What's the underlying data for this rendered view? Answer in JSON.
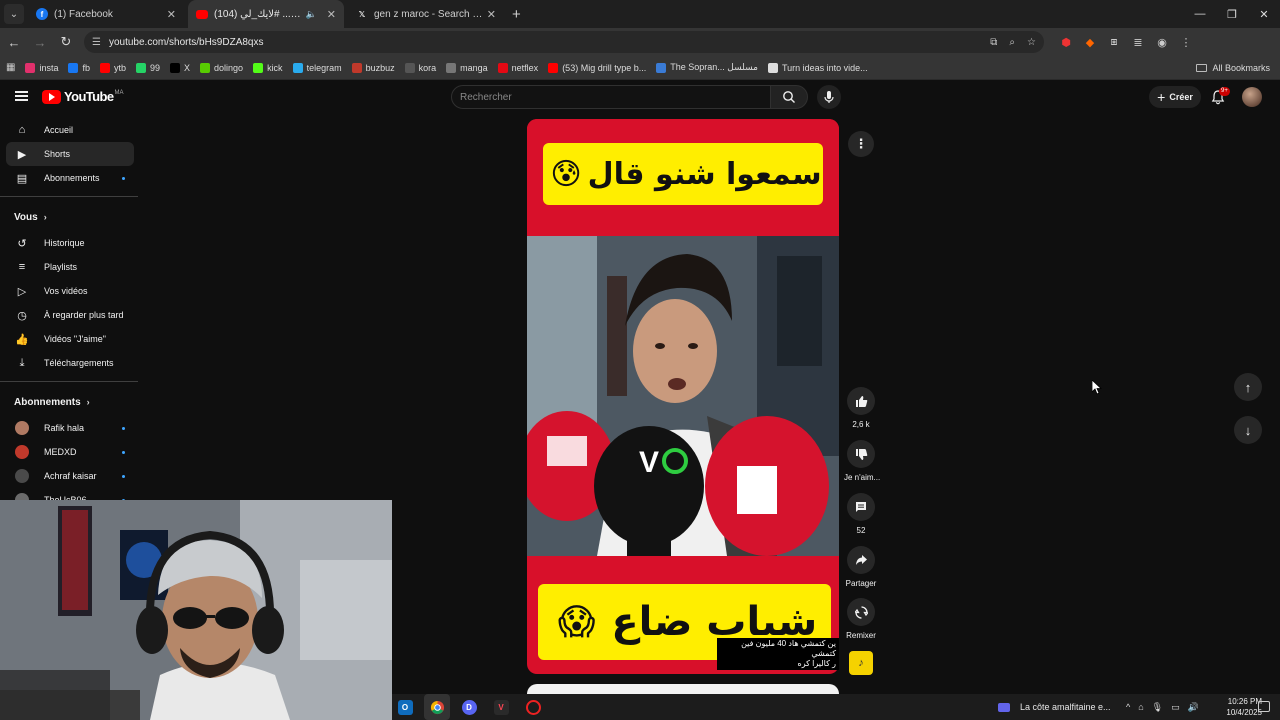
{
  "browser": {
    "tabs": [
      {
        "title": "(1) Facebook",
        "active": false,
        "favicon": "facebook-icon",
        "color": "#1877f2"
      },
      {
        "title": "(104) شباب ضاع... #لايك_لي",
        "active": true,
        "favicon": "youtube-icon",
        "color": "#ff0000"
      },
      {
        "title": "gen z maroc - Search / X",
        "active": false,
        "favicon": "x-icon",
        "color": "#000000"
      }
    ],
    "url": "youtube.com/shorts/bHs9DZA8qxs",
    "bookmarks": [
      {
        "label": "insta",
        "color": "#e1306c",
        "icon": "instagram-icon"
      },
      {
        "label": "fb",
        "color": "#1877f2",
        "icon": "facebook-icon"
      },
      {
        "label": "ytb",
        "color": "#ff0000",
        "icon": "youtube-icon"
      },
      {
        "label": "99",
        "color": "#25d366",
        "icon": "whatsapp-icon"
      },
      {
        "label": "X",
        "color": "#000000",
        "icon": "x-icon"
      },
      {
        "label": "dolingo",
        "color": "#58cc02",
        "icon": "duolingo-icon"
      },
      {
        "label": "kick",
        "color": "#53fc18",
        "icon": "kick-icon"
      },
      {
        "label": "telegram",
        "color": "#2aabee",
        "icon": "telegram-icon"
      },
      {
        "label": "buzbuz",
        "color": "#c0392b",
        "icon": "buzbuz-icon"
      },
      {
        "label": "kora",
        "color": "#555555",
        "icon": "kora-icon"
      },
      {
        "label": "manga",
        "color": "#777777",
        "icon": "manga-icon"
      },
      {
        "label": "netflex",
        "color": "#e50914",
        "icon": "netflix-icon"
      },
      {
        "label": "(53) Mig drill type b...",
        "color": "#ff0000",
        "icon": "youtube-icon"
      },
      {
        "label": "The Sopran... مسلسل",
        "color": "#3a7bd5",
        "icon": "location-icon"
      },
      {
        "label": "Turn ideas into vide...",
        "color": "#dddddd",
        "icon": "gear-icon"
      }
    ],
    "all_bookmarks": "All Bookmarks"
  },
  "youtube": {
    "logo_text": "YouTube",
    "country": "MA",
    "search_placeholder": "Rechercher",
    "create_label": "Créer",
    "notif_count": "9+",
    "sidebar": {
      "main": [
        {
          "label": "Accueil",
          "icon": "home-icon",
          "glyph": "⌂"
        },
        {
          "label": "Shorts",
          "icon": "shorts-icon",
          "glyph": "▶",
          "active": true
        },
        {
          "label": "Abonnements",
          "icon": "subscriptions-icon",
          "glyph": "▤",
          "dot": true
        }
      ],
      "you_header": "Vous",
      "you": [
        {
          "label": "Historique",
          "icon": "history-icon",
          "glyph": "↺"
        },
        {
          "label": "Playlists",
          "icon": "playlists-icon",
          "glyph": "≡"
        },
        {
          "label": "Vos vidéos",
          "icon": "your-videos-icon",
          "glyph": "▷"
        },
        {
          "label": "À regarder plus tard",
          "icon": "watch-later-icon",
          "glyph": "◷"
        },
        {
          "label": "Vidéos \"J'aime\"",
          "icon": "liked-videos-icon",
          "glyph": "👍"
        },
        {
          "label": "Téléchargements",
          "icon": "downloads-icon",
          "glyph": "⤓"
        }
      ],
      "subs_header": "Abonnements",
      "subs": [
        {
          "label": "Rafik hala",
          "color": "#b07a63"
        },
        {
          "label": "MEDXD",
          "color": "#c0392b"
        },
        {
          "label": "Achraf kaisar",
          "color": "#4a4a4a"
        },
        {
          "label": "TheUcB06",
          "color": "#6b6b6b"
        }
      ]
    },
    "short": {
      "top_banner": "سمعوا شنو قال",
      "top_emoji": "😰",
      "bottom_banner": "شباب ضاع",
      "bottom_emoji": "😱",
      "caption_line1": "ين كتمشي هاد 40 مليون فين كتمشي",
      "caption_line2": "ر كاليرا كره"
    },
    "actions": {
      "likes": "2,6 k",
      "dislike": "Je n'aim...",
      "comments": "52",
      "share": "Partager",
      "remix": "Remixer"
    }
  },
  "taskbar": {
    "media_title": "La côte amalfitaine e...",
    "time": "10:26 PM",
    "date": "10/4/2025"
  }
}
